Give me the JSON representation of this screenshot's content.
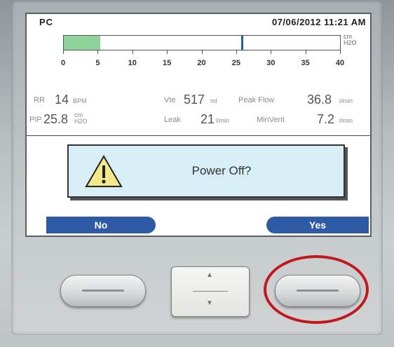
{
  "header": {
    "mode": "PC",
    "datetime": "07/06/2012 11:21 AM"
  },
  "pressure_bar": {
    "unit_line1": "cm",
    "unit_line2": "H2O",
    "scale_min": 0,
    "scale_max": 40,
    "fill_value": 5.3,
    "marker_value": 25.8,
    "ticks": [
      "0",
      "5",
      "10",
      "15",
      "20",
      "25",
      "30",
      "35",
      "40"
    ]
  },
  "readings": {
    "rr": {
      "label": "RR",
      "value": "14",
      "unit": "BPM"
    },
    "vte": {
      "label": "Vte",
      "value": "517",
      "unit": "ml"
    },
    "peak_flow": {
      "label": "Peak Flow",
      "value": "36.8",
      "unit": "l/min"
    },
    "pip": {
      "label": "PIP",
      "value": "25.8",
      "unit_top": "cm",
      "unit_bottom": "H2O"
    },
    "leak": {
      "label": "Leak",
      "value": "21",
      "unit": "l/min"
    },
    "min_vent": {
      "label": "MinVent",
      "value": "7.2",
      "unit": "l/min"
    }
  },
  "dialog": {
    "message": "Power Off?",
    "icon": "warning-icon"
  },
  "softkeys": {
    "no_label": "No",
    "yes_label": "Yes"
  },
  "colors": {
    "accent": "#2f5aa6",
    "dialog_bg": "#d7eef6",
    "bar_fill": "#8ed39c",
    "marker": "#1f5fb0",
    "highlight": "#c3181f"
  }
}
